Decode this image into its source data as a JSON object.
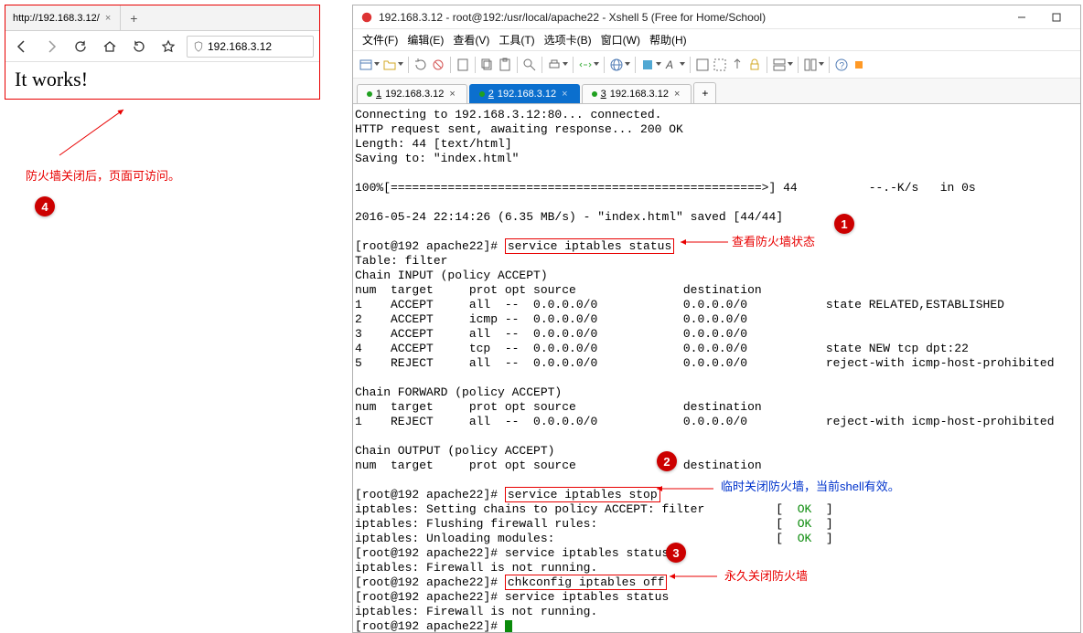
{
  "browser": {
    "tab_url": "http://192.168.3.12/",
    "tab_close": "×",
    "tab_plus": "+",
    "address": "192.168.3.12",
    "page_text": "It works!"
  },
  "annotations": {
    "note4_text": "防火墙关闭后，页面可访问。",
    "note1_text": "查看防火墙状态",
    "note2_text": "临时关闭防火墙，当前shell有效。",
    "note3_text": "永久关闭防火墙",
    "b1": "1",
    "b2": "2",
    "b3": "3",
    "b4": "4"
  },
  "xshell": {
    "title": "192.168.3.12 - root@192:/usr/local/apache22 - Xshell 5 (Free for Home/School)",
    "menu": [
      "文件(F)",
      "编辑(E)",
      "查看(V)",
      "工具(T)",
      "选项卡(B)",
      "窗口(W)",
      "帮助(H)"
    ],
    "tabs": [
      {
        "label": "1 192.168.3.12",
        "num": "1",
        "ip": "192.168.3.12",
        "active": false
      },
      {
        "label": "2 192.168.3.12",
        "num": "2",
        "ip": "192.168.3.12",
        "active": true
      },
      {
        "label": "3 192.168.3.12",
        "num": "3",
        "ip": "192.168.3.12",
        "active": false
      }
    ],
    "tab_plus": "+",
    "term": {
      "l0": "Connecting to 192.168.3.12:80... connected.",
      "l1": "HTTP request sent, awaiting response... 200 OK",
      "l2": "Length: 44 [text/html]",
      "l3": "Saving to: \"index.html\"",
      "l4": "",
      "l5a": "100%[====================================================>] 44          --.-K/s   in 0s",
      "l6": "",
      "l7": "2016-05-24 22:14:26 (6.35 MB/s) - \"index.html\" saved [44/44]",
      "l8": "",
      "l9a": "[root@192 apache22]# ",
      "l9b": "service iptables status",
      "l10": "Table: filter",
      "l11": "Chain INPUT (policy ACCEPT)",
      "l12": "num  target     prot opt source               destination",
      "l13": "1    ACCEPT     all  --  0.0.0.0/0            0.0.0.0/0           state RELATED,ESTABLISHED",
      "l14": "2    ACCEPT     icmp --  0.0.0.0/0            0.0.0.0/0",
      "l15": "3    ACCEPT     all  --  0.0.0.0/0            0.0.0.0/0",
      "l16": "4    ACCEPT     tcp  --  0.0.0.0/0            0.0.0.0/0           state NEW tcp dpt:22",
      "l17": "5    REJECT     all  --  0.0.0.0/0            0.0.0.0/0           reject-with icmp-host-prohibited",
      "l18": "",
      "l19": "Chain FORWARD (policy ACCEPT)",
      "l20": "num  target     prot opt source               destination",
      "l21": "1    REJECT     all  --  0.0.0.0/0            0.0.0.0/0           reject-with icmp-host-prohibited",
      "l22": "",
      "l23": "Chain OUTPUT (policy ACCEPT)",
      "l24": "num  target     prot opt source               destination",
      "l25": "",
      "l26a": "[root@192 apache22]# ",
      "l26b": "service iptables stop",
      "l27a": "iptables: Setting chains to policy ACCEPT: filter          [  ",
      "ok": "OK",
      "l27c": "  ]",
      "l28a": "iptables: Flushing firewall rules:                         [  ",
      "l29a": "iptables: Unloading modules:                               [  ",
      "l30": "[root@192 apache22]# service iptables status",
      "l31": "iptables: Firewall is not running.",
      "l32a": "[root@192 apache22]# ",
      "l32b": "chkconfig iptables off",
      "l33": "[root@192 apache22]# service iptables status",
      "l34": "iptables: Firewall is not running.",
      "l35": "[root@192 apache22]# "
    }
  }
}
